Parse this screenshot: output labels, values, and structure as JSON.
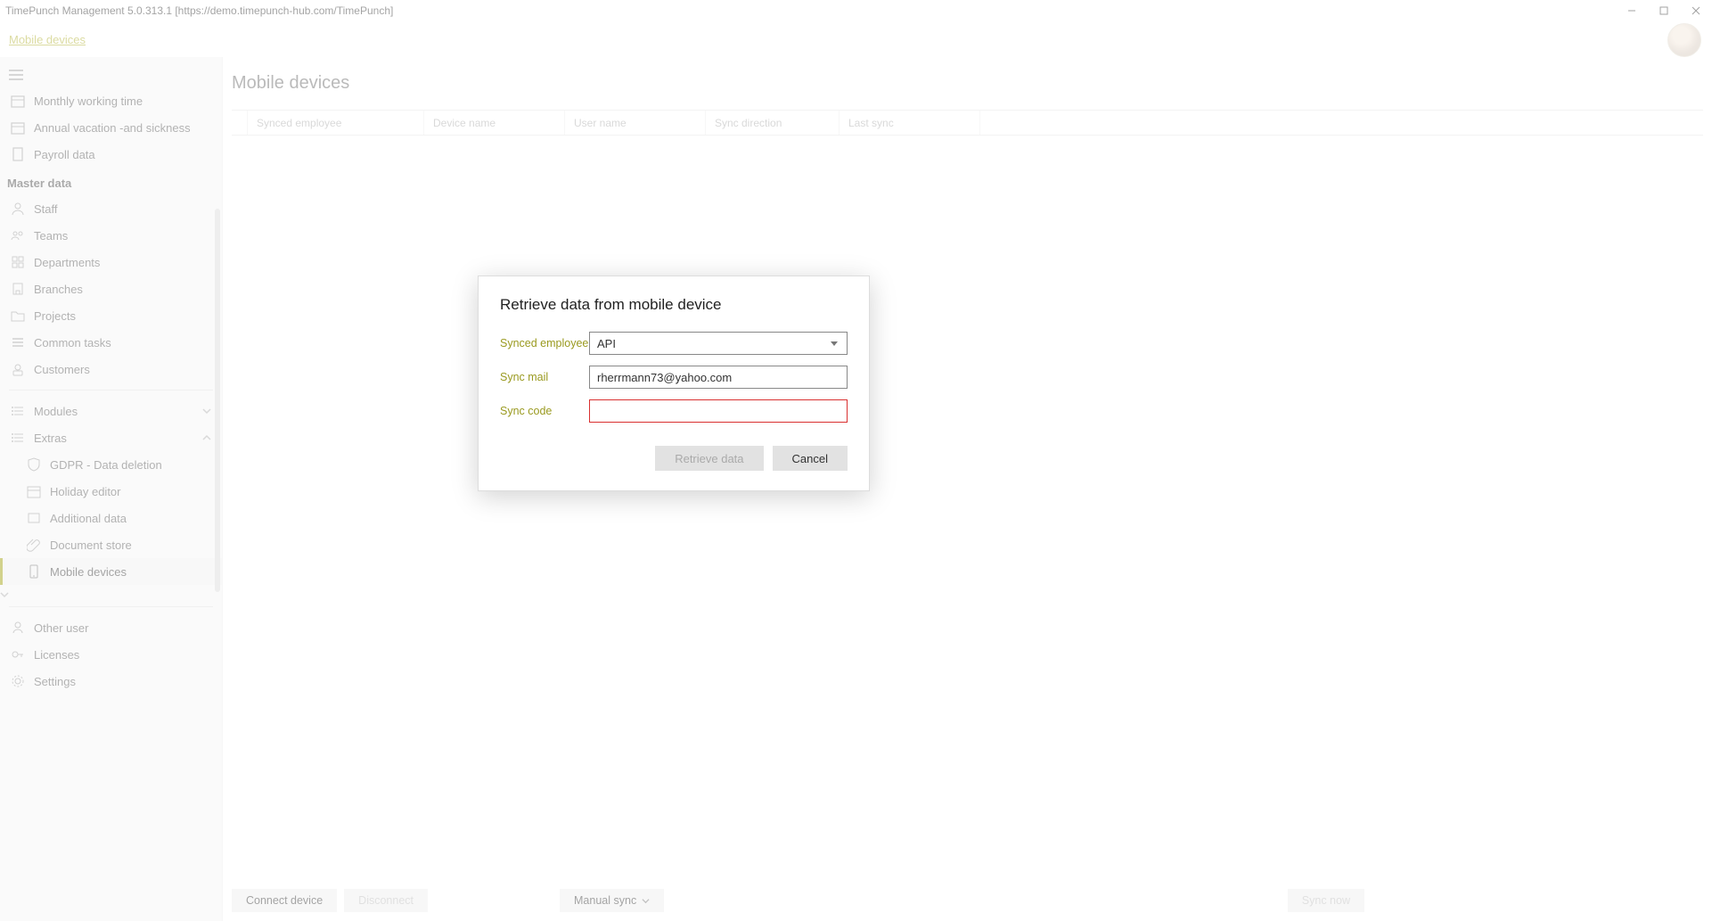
{
  "window": {
    "title": "TimePunch Management 5.0.313.1  [https://demo.timepunch-hub.com/TimePunch]"
  },
  "breadcrumb": {
    "label": "Mobile devices"
  },
  "sidebar": {
    "items_top": [
      {
        "label": "Monthly working time"
      },
      {
        "label": "Annual vacation -and sickness"
      },
      {
        "label": "Payroll data"
      }
    ],
    "section_master": "Master data",
    "items_master": [
      {
        "label": "Staff"
      },
      {
        "label": "Teams"
      },
      {
        "label": "Departments"
      },
      {
        "label": "Branches"
      },
      {
        "label": "Projects"
      },
      {
        "label": "Common tasks"
      },
      {
        "label": "Customers"
      }
    ],
    "modules_label": "Modules",
    "extras_label": "Extras",
    "items_extras": [
      {
        "label": "GDPR - Data deletion"
      },
      {
        "label": "Holiday editor"
      },
      {
        "label": "Additional data"
      },
      {
        "label": "Document store"
      },
      {
        "label": "Mobile devices"
      }
    ],
    "items_bottom": [
      {
        "label": "Other user"
      },
      {
        "label": "Licenses"
      },
      {
        "label": "Settings"
      }
    ]
  },
  "page": {
    "title": "Mobile devices",
    "columns": {
      "c1": "Synced employee",
      "c2": "Device name",
      "c3": "User name",
      "c4": "Sync direction",
      "c5": "Last sync"
    }
  },
  "actions": {
    "connect": "Connect device",
    "disconnect": "Disconnect",
    "manual": "Manual sync",
    "sync_now": "Sync now"
  },
  "modal": {
    "title": "Retrieve data from mobile device",
    "labels": {
      "employee": "Synced employee",
      "mail": "Sync mail",
      "code": "Sync code"
    },
    "values": {
      "employee": "API",
      "mail": "rherrmann73@yahoo.com",
      "code": ""
    },
    "buttons": {
      "retrieve": "Retrieve data",
      "cancel": "Cancel"
    }
  }
}
